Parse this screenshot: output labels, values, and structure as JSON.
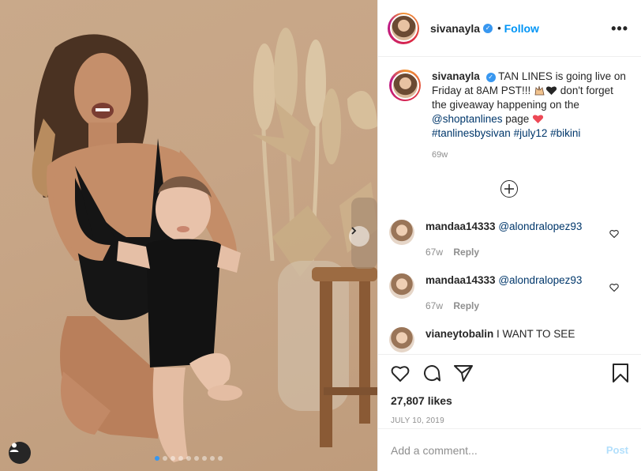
{
  "post": {
    "username": "sivanayla",
    "follow_label": "Follow",
    "more_label": "•••",
    "separator": "•",
    "photo_count": 9,
    "active_photo": 0
  },
  "caption": {
    "username": "sivanayla",
    "text_1": "TAN LINES is going live on Friday at 8AM PST!!! ",
    "text_2": " don't forget the giveaway happening on the ",
    "mention": "@shoptanlines",
    "text_3": " page ",
    "hashtags": [
      "#tanlinesbysivan",
      "#july12",
      "#bikini"
    ],
    "age": "69w"
  },
  "comments": [
    {
      "username": "mandaa14333",
      "mention": "@alondralopez93",
      "age": "67w",
      "reply_label": "Reply"
    },
    {
      "username": "mandaa14333",
      "mention": "@alondralopez93",
      "age": "67w",
      "reply_label": "Reply"
    },
    {
      "username": "vianeytobalin",
      "text": "I WANT TO SEE"
    }
  ],
  "likes": "27,807 likes",
  "date": "JULY 10, 2019",
  "add_comment": {
    "placeholder": "Add a comment...",
    "post_label": "Post"
  },
  "colors": {
    "accent": "#0095f6",
    "verified": "#3897f0",
    "post_disabled": "#b2dffc",
    "heart_red": "#ed4956"
  }
}
